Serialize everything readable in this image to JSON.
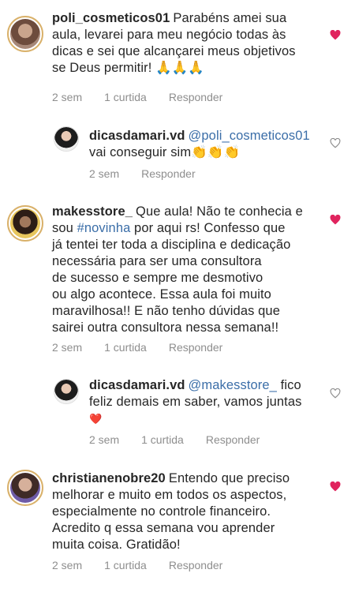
{
  "comments": [
    {
      "username": "poli_cosmeticos01",
      "lines": [
        "Parabéns amei sua",
        "aula, levarei para meu negócio todas às",
        "dicas e sei que alcançarei meus objetivos",
        "se Deus permitir! 🙏🙏🙏"
      ],
      "time": "2 sem",
      "likes": "1 curtida",
      "reply": "Responder",
      "liked": true
    },
    {
      "username": "dicasdamari.vd",
      "mention": "@poli_cosmeticos01",
      "lines": [
        "",
        "vai conseguir sim👏👏👏"
      ],
      "time": "2 sem",
      "reply": "Responder",
      "liked": false
    },
    {
      "username": "makesstore_",
      "first_text": "Que aula! Não te conhecia e",
      "line2_pre": "sou ",
      "hashtag": "#novinha",
      "line2_post": " por aqui rs! Confesso que",
      "lines": [
        "já tentei ter toda a disciplina e dedicação",
        "necessária para ser uma consultora",
        "de sucesso e sempre me desmotivo",
        "ou algo acontece. Essa aula foi muito",
        "maravilhosa!! E não tenho dúvidas que",
        "sairei outra consultora nessa semana!!"
      ],
      "time": "2 sem",
      "likes": "1 curtida",
      "reply": "Responder",
      "liked": true
    },
    {
      "username": "dicasdamari.vd",
      "mention": "@makesstore_",
      "first_text": "fico",
      "lines": [
        "feliz demais em saber, vamos juntas",
        "❤️"
      ],
      "time": "2 sem",
      "likes": "1 curtida",
      "reply": "Responder",
      "liked": false
    },
    {
      "username": "christianenobre20",
      "first_text": "Entendo que preciso",
      "lines": [
        "melhorar e muito em todos os aspectos,",
        "especialmente no controle financeiro.",
        "Acredito q essa semana vou aprender",
        "muita coisa.  Gratidão!"
      ],
      "time": "2 sem",
      "likes": "1 curtida",
      "reply": "Responder",
      "liked": true
    }
  ],
  "colors": {
    "liked_heart": "#e0245e",
    "unliked_heart": "#8e8e8e",
    "link": "#3b6ea8",
    "meta": "#8e8e8e"
  },
  "icons": {
    "liked": "heart-filled-icon",
    "unliked": "heart-outline-icon"
  }
}
